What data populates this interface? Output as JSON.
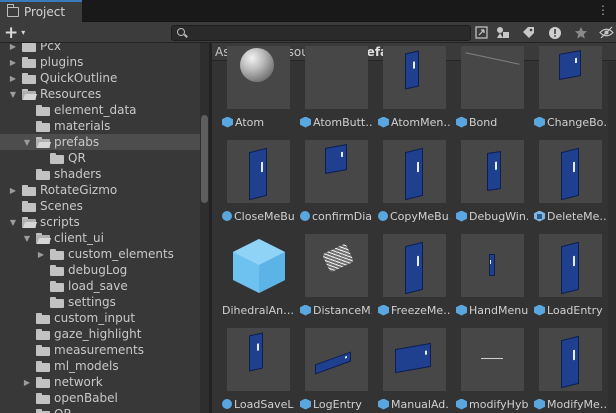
{
  "window": {
    "tab_title": "Project",
    "menu_glyph": "⋮"
  },
  "toolbar": {
    "add_label": "+",
    "add_caret": "▾",
    "search_value": "",
    "search_placeholder": "",
    "icons": [
      "search-by-type-icon",
      "filter-by-label-icon",
      "tag-icon",
      "warning-icon",
      "favorite-star-icon",
      "hidden-packages-icon"
    ]
  },
  "tree": {
    "rows": [
      {
        "label": "Pcx",
        "indent": 1,
        "arrow": "▶",
        "open": false
      },
      {
        "label": "plugins",
        "indent": 1,
        "arrow": "▶",
        "open": false
      },
      {
        "label": "QuickOutline",
        "indent": 1,
        "arrow": "▶",
        "open": false
      },
      {
        "label": "Resources",
        "indent": 1,
        "arrow": "▼",
        "open": true
      },
      {
        "label": "element_data",
        "indent": 2,
        "arrow": "",
        "open": false
      },
      {
        "label": "materials",
        "indent": 2,
        "arrow": "",
        "open": false
      },
      {
        "label": "prefabs",
        "indent": 2,
        "arrow": "▼",
        "open": true,
        "selected": true
      },
      {
        "label": "QR",
        "indent": 3,
        "arrow": "",
        "open": false
      },
      {
        "label": "shaders",
        "indent": 2,
        "arrow": "",
        "open": false
      },
      {
        "label": "RotateGizmo",
        "indent": 1,
        "arrow": "▶",
        "open": false
      },
      {
        "label": "Scenes",
        "indent": 1,
        "arrow": "",
        "open": false
      },
      {
        "label": "scripts",
        "indent": 1,
        "arrow": "▼",
        "open": true
      },
      {
        "label": "client_ui",
        "indent": 2,
        "arrow": "▼",
        "open": true
      },
      {
        "label": "custom_elements",
        "indent": 3,
        "arrow": "▶",
        "open": false
      },
      {
        "label": "debugLog",
        "indent": 3,
        "arrow": "",
        "open": false
      },
      {
        "label": "load_save",
        "indent": 3,
        "arrow": "",
        "open": false
      },
      {
        "label": "settings",
        "indent": 3,
        "arrow": "",
        "open": false
      },
      {
        "label": "custom_input",
        "indent": 2,
        "arrow": "",
        "open": false
      },
      {
        "label": "gaze_highlight",
        "indent": 2,
        "arrow": "",
        "open": false
      },
      {
        "label": "measurements",
        "indent": 2,
        "arrow": "",
        "open": false
      },
      {
        "label": "ml_models",
        "indent": 2,
        "arrow": "",
        "open": false
      },
      {
        "label": "network",
        "indent": 2,
        "arrow": "▶",
        "open": false
      },
      {
        "label": "openBabel",
        "indent": 2,
        "arrow": "",
        "open": false
      },
      {
        "label": "QR",
        "indent": 2,
        "arrow": "",
        "open": false
      }
    ]
  },
  "breadcrumb": {
    "items": [
      "Assets",
      "Resources"
    ],
    "current": "prefabs",
    "separator": "›"
  },
  "assets": [
    {
      "name": "Atom",
      "icon": "prefab",
      "preview": "sphere"
    },
    {
      "name": "AtomButt…",
      "icon": "prefab",
      "preview": "empty"
    },
    {
      "name": "AtomMen…",
      "icon": "prefab",
      "preview": "panel-tilt"
    },
    {
      "name": "Bond",
      "icon": "prefab",
      "preview": "bond"
    },
    {
      "name": "ChangeBo…",
      "icon": "prefab",
      "preview": "panel-small"
    },
    {
      "name": "CloseMeBu…",
      "icon": "variant",
      "preview": "panel"
    },
    {
      "name": "confirmDia…",
      "icon": "variant",
      "preview": "panel-small"
    },
    {
      "name": "CopyMeBu…",
      "icon": "variant",
      "preview": "panel"
    },
    {
      "name": "DebugWin…",
      "icon": "prefab",
      "preview": "panel-narrow"
    },
    {
      "name": "DeleteMe…",
      "icon": "model",
      "preview": "panel"
    },
    {
      "name": "DihedralAn…",
      "icon": "none",
      "preview": "bigcube"
    },
    {
      "name": "DistanceM…",
      "icon": "prefab",
      "preview": "distance"
    },
    {
      "name": "FreezeMe…",
      "icon": "prefab",
      "preview": "panel"
    },
    {
      "name": "HandMenu",
      "icon": "prefab",
      "preview": "panel-thin"
    },
    {
      "name": "LoadEntry",
      "icon": "prefab",
      "preview": "panel"
    },
    {
      "name": "LoadSaveL…",
      "icon": "variant",
      "preview": "panel-tilt"
    },
    {
      "name": "LogEntry",
      "icon": "prefab",
      "preview": "panel-flat"
    },
    {
      "name": "ManualAd…",
      "icon": "prefab",
      "preview": "panel-wide"
    },
    {
      "name": "modifyHybr…",
      "icon": "prefab",
      "preview": "dots"
    },
    {
      "name": "ModifyMe…",
      "icon": "prefab",
      "preview": "panel"
    }
  ],
  "colors": {
    "accent": "#3a79bb",
    "prefab_icon": "#5aa7e0",
    "panel_blue": "#1f3f8f"
  }
}
